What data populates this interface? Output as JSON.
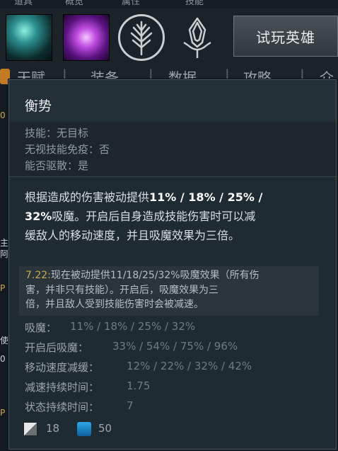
{
  "background": {
    "top_tabs": [
      "道具",
      "概览",
      "属性",
      "技能"
    ],
    "trial_button": "试玩英雄",
    "nav_tabs": [
      "天赋",
      "装备",
      "数据",
      "攻略",
      "介"
    ],
    "tab_separator": "|",
    "left_partials": [
      "0",
      "主",
      "阿",
      "P",
      "使",
      "0",
      "P"
    ]
  },
  "tooltip": {
    "title": "衡势",
    "properties": [
      "技能：无目标",
      "无视技能免疫：否",
      "能否驱散：是"
    ],
    "description": {
      "line1_pre": "根据造成的伤害被动提供",
      "line1_bold": "11% / 18% / 25% /",
      "line2_bold": "32%",
      "line2_post": "吸魔。开启后自身造成技能伤害时可以减",
      "line3": "缓敌人的移动速度，并且吸魔效果为三倍。"
    },
    "patch_note": {
      "version": "7.22:",
      "line1": "现在被动提供11/18/25/32%吸魔效果（所有伤",
      "line2": "害，并非只有技能）。开启后，吸魔效果为三",
      "line3": "倍，并且敌人受到技能伤害时会被减速。"
    },
    "stats": [
      {
        "label": "吸魔：",
        "value": "11% / 18% / 25% / 32%"
      },
      {
        "label": "开启后吸魔：",
        "value": "33% / 54% / 75% / 96%"
      },
      {
        "label": "移动速度减缓：",
        "value": "12% / 22% / 32% / 42%"
      },
      {
        "label": "减速持续时间：",
        "value": "1.75"
      },
      {
        "label": "状态持续时间：",
        "value": "7"
      }
    ],
    "cooldown": "18",
    "mana_cost": "50"
  }
}
